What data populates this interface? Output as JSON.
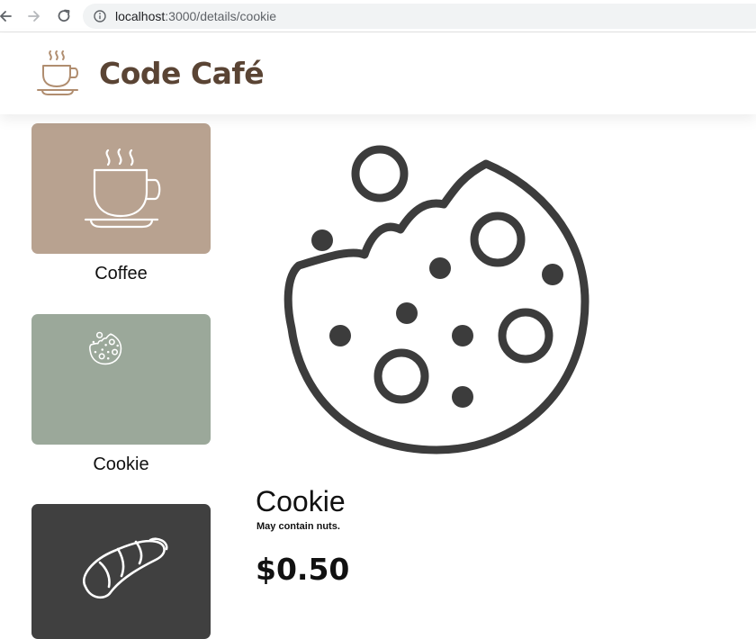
{
  "browser": {
    "url_host": "localhost",
    "url_path": ":3000/details/cookie"
  },
  "header": {
    "title": "Code Café",
    "logo_icon": "coffee-cup-icon",
    "title_color": "#5a4434"
  },
  "menu": {
    "items": [
      {
        "label": "Coffee",
        "icon": "coffee-cup-icon",
        "color": "#b8a290"
      },
      {
        "label": "Cookie",
        "icon": "cookie-icon",
        "color": "#9ba89a"
      },
      {
        "label": "",
        "icon": "croissant-icon",
        "color": "#404040"
      }
    ]
  },
  "product": {
    "name": "Cookie",
    "description": "May contain nuts.",
    "price": "$0.50",
    "image_icon": "cookie-icon"
  }
}
